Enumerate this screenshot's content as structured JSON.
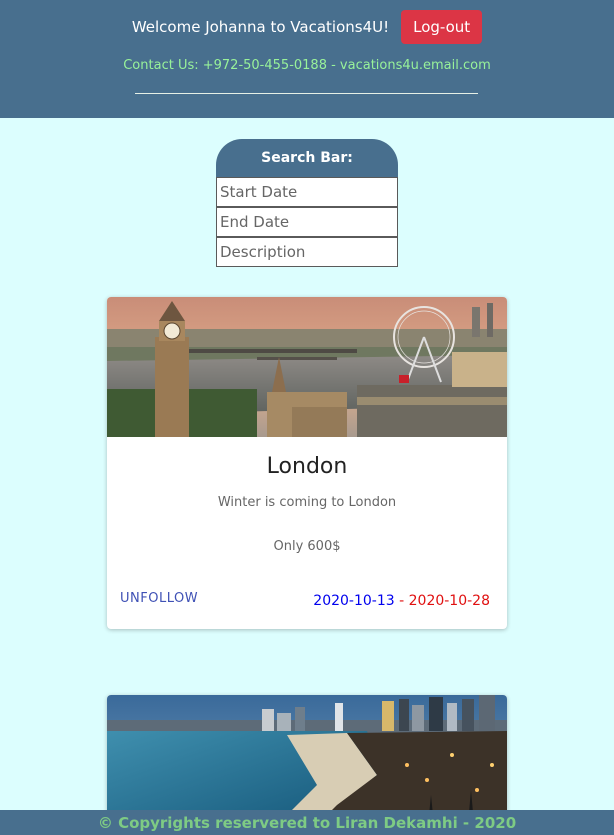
{
  "header": {
    "welcome": "Welcome Johanna to Vacations4U!",
    "logout_label": "Log-out",
    "contact": "Contact Us: +972-50-455-0188 - vacations4u.email.com"
  },
  "search": {
    "title": "Search Bar:",
    "start_placeholder": "Start Date",
    "end_placeholder": "End Date",
    "description_placeholder": "Description"
  },
  "vacations": [
    {
      "title": "London",
      "description": "Winter is coming to London",
      "price": "Only 600$",
      "follow_label": "UNFOLLOW",
      "start_date": "2020-10-13",
      "date_separator": " - ",
      "end_date": "2020-10-28"
    }
  ],
  "footer": {
    "text": "© Copyrights reservered to Liran Dekamhi - 2020"
  }
}
